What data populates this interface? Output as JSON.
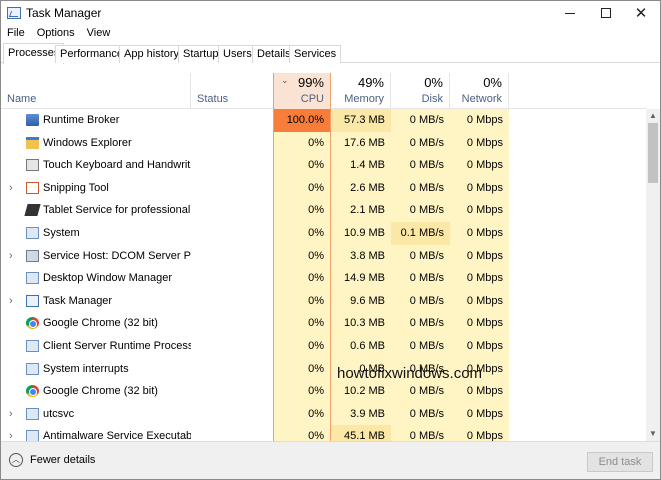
{
  "window": {
    "title": "Task Manager",
    "controls": {
      "minimize": "—",
      "maximize": "☐",
      "close": "✕"
    }
  },
  "menu": [
    "File",
    "Options",
    "View"
  ],
  "tabs": [
    {
      "label": "Processes",
      "active": true
    },
    {
      "label": "Performance",
      "active": false
    },
    {
      "label": "App history",
      "active": false
    },
    {
      "label": "Startup",
      "active": false
    },
    {
      "label": "Users",
      "active": false
    },
    {
      "label": "Details",
      "active": false
    },
    {
      "label": "Services",
      "active": false
    }
  ],
  "columns": {
    "name": "Name",
    "status": "Status",
    "cpu": {
      "label": "CPU",
      "total": "99%"
    },
    "memory": {
      "label": "Memory",
      "total": "49%"
    },
    "disk": {
      "label": "Disk",
      "total": "0%"
    },
    "network": {
      "label": "Network",
      "total": "0%"
    }
  },
  "processes": [
    {
      "name": "Runtime Broker",
      "icon": "broker-icon",
      "expandable": false,
      "cpu": "100.0%",
      "memory": "57.3 MB",
      "disk": "0 MB/s",
      "network": "0 Mbps"
    },
    {
      "name": "Windows Explorer",
      "icon": "folder-icon",
      "expandable": false,
      "cpu": "0%",
      "memory": "17.6 MB",
      "disk": "0 MB/s",
      "network": "0 Mbps"
    },
    {
      "name": "Touch Keyboard and Handwriti...",
      "icon": "keyboard-icon",
      "expandable": false,
      "cpu": "0%",
      "memory": "1.4 MB",
      "disk": "0 MB/s",
      "network": "0 Mbps"
    },
    {
      "name": "Snipping Tool",
      "icon": "scissors-icon",
      "expandable": true,
      "cpu": "0%",
      "memory": "2.6 MB",
      "disk": "0 MB/s",
      "network": "0 Mbps"
    },
    {
      "name": "Tablet Service for professional d...",
      "icon": "pen-icon",
      "expandable": false,
      "cpu": "0%",
      "memory": "2.1 MB",
      "disk": "0 MB/s",
      "network": "0 Mbps"
    },
    {
      "name": "System",
      "icon": "system-icon",
      "expandable": false,
      "cpu": "0%",
      "memory": "10.9 MB",
      "disk": "0.1 MB/s",
      "network": "0 Mbps"
    },
    {
      "name": "Service Host: DCOM Server Proc...",
      "icon": "gear-icon",
      "expandable": true,
      "cpu": "0%",
      "memory": "3.8 MB",
      "disk": "0 MB/s",
      "network": "0 Mbps"
    },
    {
      "name": "Desktop Window Manager",
      "icon": "window-icon",
      "expandable": false,
      "cpu": "0%",
      "memory": "14.9 MB",
      "disk": "0 MB/s",
      "network": "0 Mbps"
    },
    {
      "name": "Task Manager",
      "icon": "task-manager-icon",
      "expandable": true,
      "cpu": "0%",
      "memory": "9.6 MB",
      "disk": "0 MB/s",
      "network": "0 Mbps"
    },
    {
      "name": "Google Chrome (32 bit)",
      "icon": "chrome-icon",
      "expandable": false,
      "cpu": "0%",
      "memory": "10.3 MB",
      "disk": "0 MB/s",
      "network": "0 Mbps"
    },
    {
      "name": "Client Server Runtime Process",
      "icon": "window-icon",
      "expandable": false,
      "cpu": "0%",
      "memory": "0.6 MB",
      "disk": "0 MB/s",
      "network": "0 Mbps"
    },
    {
      "name": "System interrupts",
      "icon": "window-icon",
      "expandable": false,
      "cpu": "0%",
      "memory": "0 MB",
      "disk": "0 MB/s",
      "network": "0 Mbps"
    },
    {
      "name": "Google Chrome (32 bit)",
      "icon": "chrome-icon",
      "expandable": false,
      "cpu": "0%",
      "memory": "10.2 MB",
      "disk": "0 MB/s",
      "network": "0 Mbps"
    },
    {
      "name": "utcsvc",
      "icon": "gear-icon",
      "expandable": true,
      "cpu": "0%",
      "memory": "3.9 MB",
      "disk": "0 MB/s",
      "network": "0 Mbps"
    },
    {
      "name": "Antimalware Service Executable",
      "icon": "window-icon",
      "expandable": true,
      "cpu": "0%",
      "memory": "45.1 MB",
      "disk": "0 MB/s",
      "network": "0 Mbps"
    }
  ],
  "footer": {
    "fewer_details": "Fewer details",
    "end_task": "End task"
  },
  "watermark": "howtofixwindows.com",
  "colors": {
    "cpu_hot": "#f97d3a",
    "heat_light": "#fff4c4",
    "heat_medium": "#fbe8a6",
    "cpu_header": "#fbe3d3",
    "column_label": "#4d6082"
  }
}
